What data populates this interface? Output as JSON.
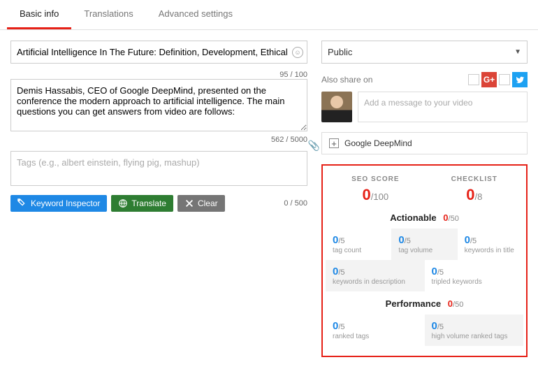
{
  "tabs": {
    "basic": "Basic info",
    "translations": "Translations",
    "advanced": "Advanced settings"
  },
  "title": {
    "value": "Artificial Intelligence In The Future: Definition, Development, Ethical Issues",
    "count": "95 / 100"
  },
  "desc": {
    "value": "Demis Hassabis, CEO of Google DeepMind, presented on the conference the modern approach to artificial intelligence. The main questions you can get answers from video are follows:",
    "count": "562 / 5000"
  },
  "tags": {
    "placeholder": "Tags (e.g., albert einstein, flying pig, mashup)",
    "count": "0 / 500"
  },
  "buttons": {
    "inspector": "Keyword Inspector",
    "translate": "Translate",
    "clear": "Clear"
  },
  "privacy": "Public",
  "share": {
    "label": "Also share on",
    "msg_placeholder": "Add a message to your video"
  },
  "suggest": "Google DeepMind",
  "seo": {
    "toplabels": {
      "score": "SEO SCORE",
      "checklist": "CHECKLIST"
    },
    "score_zero": "0",
    "score_max": "/100",
    "check_zero": "0",
    "check_max": "/8",
    "actionable_title": "Actionable",
    "actionable_zero": "0",
    "actionable_max": "/50",
    "perf_title": "Performance",
    "perf_zero": "0",
    "perf_max": "/50",
    "cells": {
      "tagcount": {
        "z": "0",
        "m": "/5",
        "l": "tag count"
      },
      "tagvolume": {
        "z": "0",
        "m": "/5",
        "l": "tag volume"
      },
      "kwtitle": {
        "z": "0",
        "m": "/5",
        "l": "keywords in title"
      },
      "kwdesc": {
        "z": "0",
        "m": "/5",
        "l": "keywords in description"
      },
      "tripled": {
        "z": "0",
        "m": "/5",
        "l": "tripled keywords"
      },
      "ranked": {
        "z": "0",
        "m": "/5",
        "l": "ranked tags"
      },
      "highvol": {
        "z": "0",
        "m": "/5",
        "l": "high volume ranked tags"
      }
    }
  }
}
